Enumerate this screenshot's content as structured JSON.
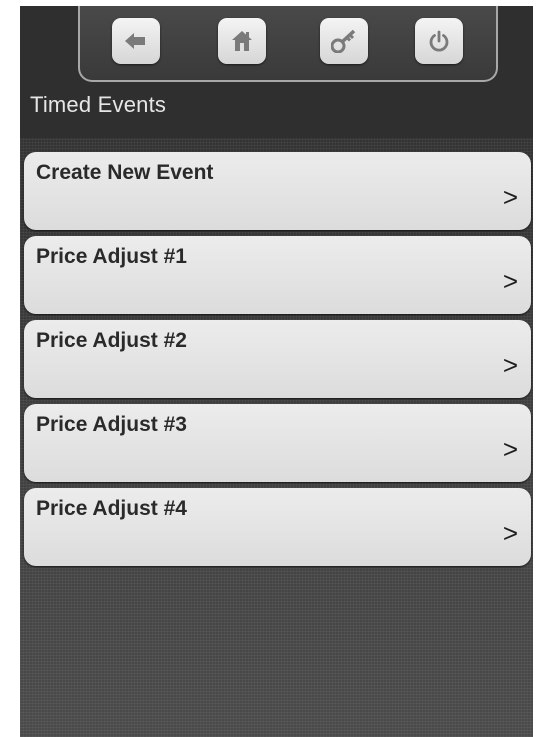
{
  "toolbar": {
    "buttons": [
      {
        "name": "back-button",
        "icon": "arrow-left-icon"
      },
      {
        "name": "home-button",
        "icon": "home-icon"
      },
      {
        "name": "key-button",
        "icon": "key-icon"
      },
      {
        "name": "power-button",
        "icon": "power-icon"
      }
    ]
  },
  "header": {
    "title": "Timed Events"
  },
  "events": [
    {
      "label": "Create New Event",
      "arrow": ">"
    },
    {
      "label": "Price Adjust #1",
      "arrow": ">"
    },
    {
      "label": "Price Adjust #2",
      "arrow": ">"
    },
    {
      "label": "Price Adjust #3",
      "arrow": ">"
    },
    {
      "label": "Price Adjust #4",
      "arrow": ">"
    }
  ],
  "colors": {
    "background": "#3b3b3b",
    "button_face": "#e6e6e6",
    "list_item": "#e4e4e4",
    "text_dark": "#2a2a2a",
    "title_text": "#e6e6e6",
    "icon_gray": "#7a7a7a"
  }
}
